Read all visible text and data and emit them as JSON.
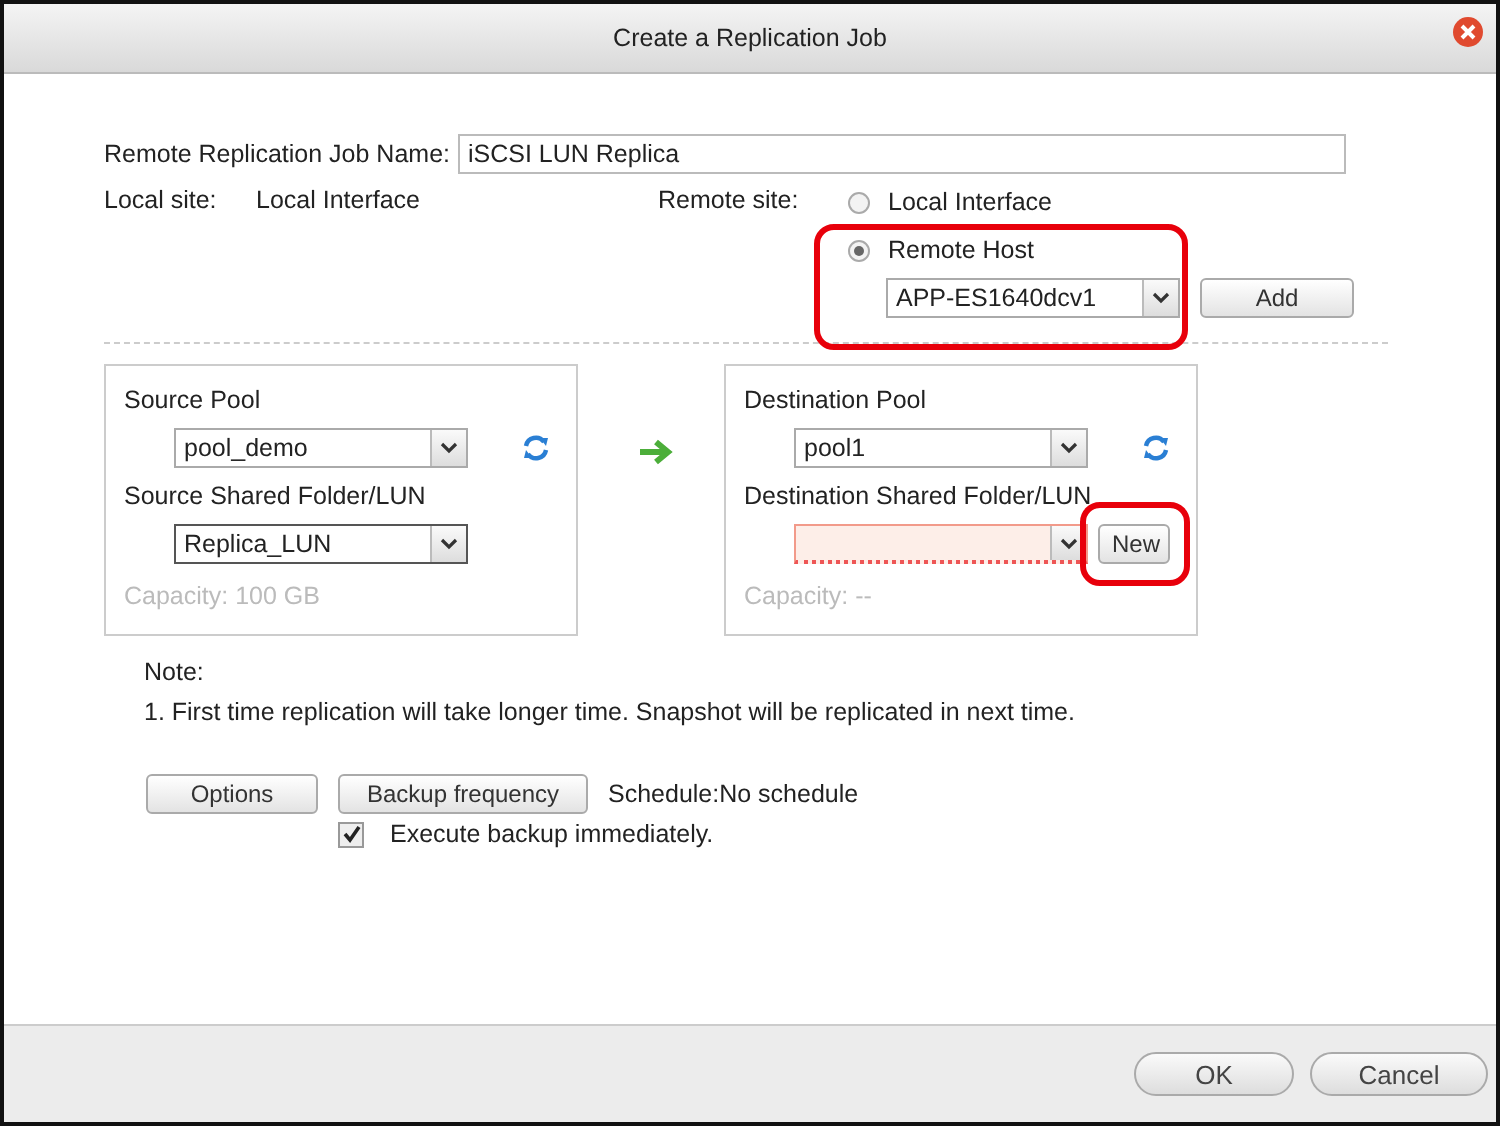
{
  "window": {
    "title": "Create a Replication Job"
  },
  "job_name": {
    "label": "Remote Replication Job Name:",
    "value": "iSCSI LUN Replica"
  },
  "local_site": {
    "label": "Local site:",
    "value": "Local Interface"
  },
  "remote_site": {
    "label": "Remote site:",
    "options": [
      {
        "label": "Local Interface",
        "selected": false
      },
      {
        "label": "Remote Host",
        "selected": true
      }
    ],
    "host_select": "APP-ES1640dcv1",
    "add_button": "Add"
  },
  "source": {
    "pool_label": "Source Pool",
    "pool": "pool_demo",
    "folder_label": "Source Shared Folder/LUN",
    "folder": "Replica_LUN",
    "folder_invalid": false,
    "capacity": "Capacity: 100 GB"
  },
  "destination": {
    "pool_label": "Destination Pool",
    "pool": "pool1",
    "folder_label": "Destination Shared Folder/LUN",
    "folder_invalid": true,
    "new_button": "New",
    "capacity": "Capacity: --"
  },
  "note": {
    "label": "Note:",
    "lines": [
      "1. First time replication will take longer time. Snapshot will be replicated in next time."
    ]
  },
  "actions": {
    "buttons": [
      "Options",
      "Backup frequency"
    ],
    "schedule": "Schedule:No schedule"
  },
  "execute_now": {
    "label": "Execute backup immediately.",
    "checked": true
  },
  "footer": {
    "buttons": [
      "OK",
      "Cancel"
    ]
  }
}
